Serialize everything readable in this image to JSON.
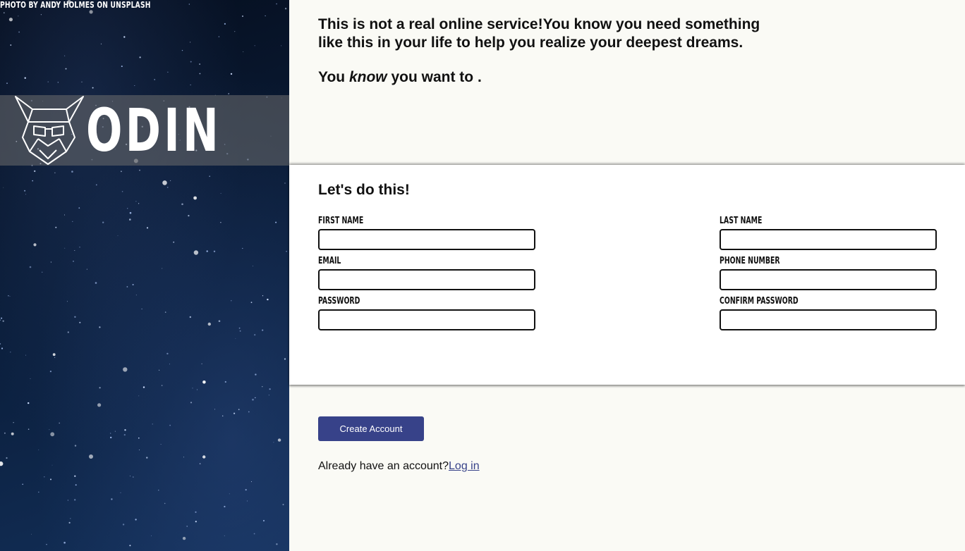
{
  "sidebar": {
    "photo_credit": "PHOTO BY ANDY HOLMES ON UNSPLASH",
    "brand_name": "ODIN",
    "logo_icon": "odin-helmet-logo"
  },
  "intro": {
    "line1": "This is not a real online service!You know you need something like this in your life to help you realize your deepest dreams.",
    "line2_prefix": "You ",
    "line2_emphasis": "know",
    "line2_suffix": " you want to ."
  },
  "form": {
    "title": "Let's do this!",
    "fields": {
      "first_name": {
        "label": "First Name",
        "value": ""
      },
      "last_name": {
        "label": "Last Name",
        "value": ""
      },
      "email": {
        "label": "Email",
        "value": ""
      },
      "phone": {
        "label": "Phone Number",
        "value": ""
      },
      "password": {
        "label": "Password",
        "value": ""
      },
      "confirm_password": {
        "label": "Confirm Password",
        "value": ""
      }
    }
  },
  "actions": {
    "create_account_label": "Create Account",
    "login_prompt": "Already have an account?",
    "login_link": "Log in"
  },
  "colors": {
    "accent": "#374289",
    "panel_bg": "#fafaf5",
    "sidebar_bg": "#0b1f3d"
  }
}
